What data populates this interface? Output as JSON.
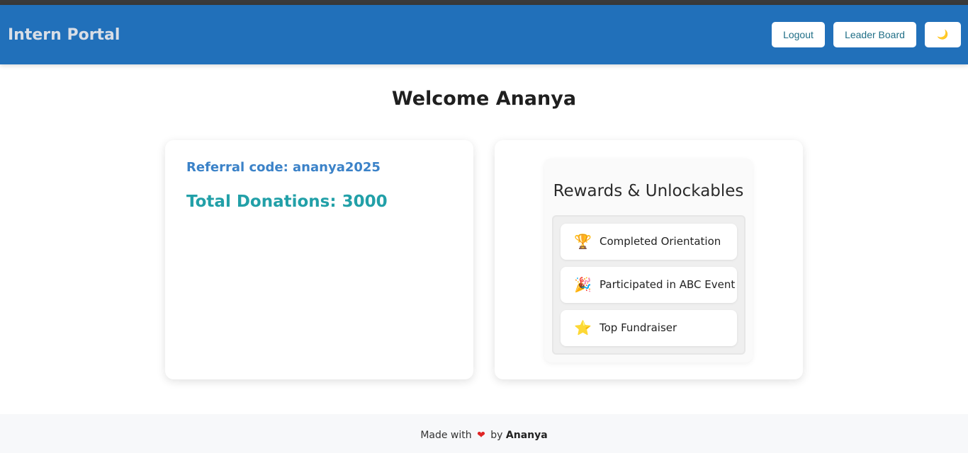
{
  "header": {
    "brand": "Intern Portal",
    "logout_label": "Logout",
    "leaderboard_label": "Leader Board",
    "theme_toggle_icon": "🌙"
  },
  "main": {
    "welcome": "Welcome Ananya",
    "stats": {
      "referral": "Referral code: ananya2025",
      "donations": "Total Donations: 3000"
    },
    "rewards": {
      "title": "Rewards & Unlockables",
      "items": [
        {
          "icon": "🏆",
          "icon_name": "trophy-icon",
          "label": "Completed Orientation"
        },
        {
          "icon": "🎉",
          "icon_name": "party-popper-icon",
          "label": "Participated in ABC Event"
        },
        {
          "icon": "⭐",
          "icon_name": "star-icon",
          "label": "Top Fundraiser"
        }
      ]
    }
  },
  "footer": {
    "made_with": "Made with",
    "heart": "❤",
    "by": "by",
    "author": "Ananya"
  },
  "colors": {
    "navbar": "#2170ba",
    "referral": "#3b82c8",
    "donations": "#22a0a8"
  }
}
